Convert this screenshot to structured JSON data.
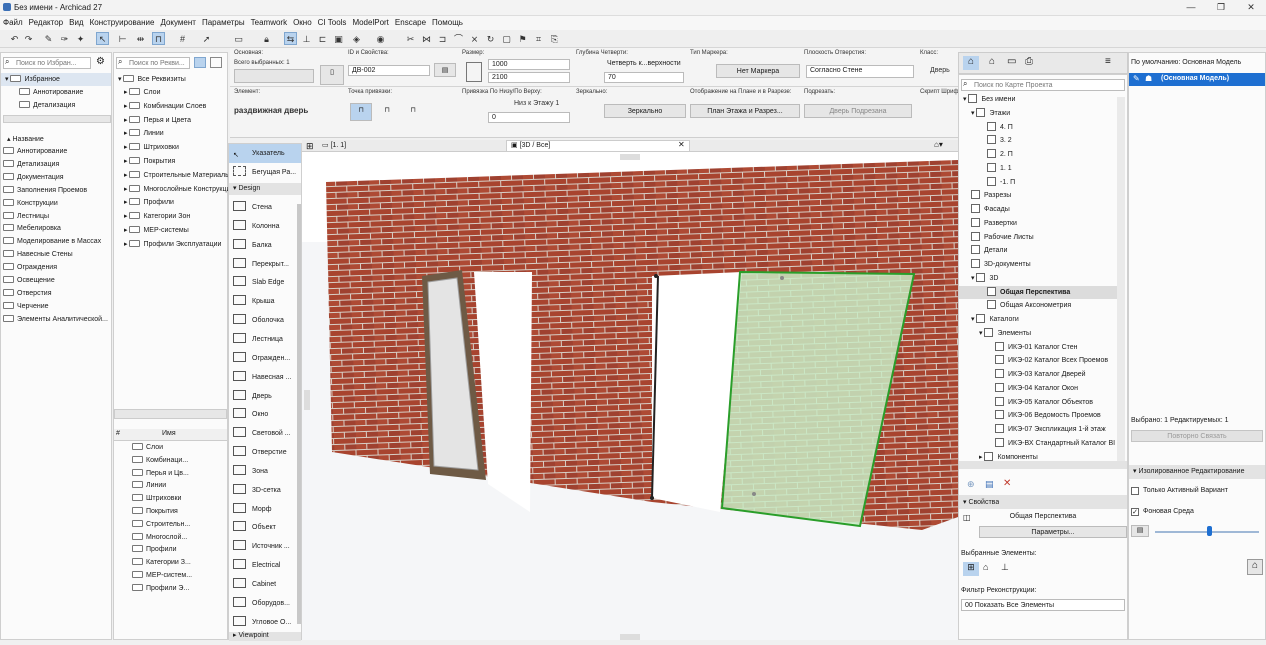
{
  "window": {
    "title": "Без имени - Archicad 27"
  },
  "menu": [
    "Файл",
    "Редактор",
    "Вид",
    "Конструирование",
    "Документ",
    "Параметры",
    "Teamwork",
    "Окно",
    "CI Tools",
    "ModelPort",
    "Enscape",
    "Помощь"
  ],
  "left": {
    "search_placeholder": "Поиск по Избран...",
    "tab": "Избранное",
    "tree": [
      "Аннотирование",
      "Детализация"
    ],
    "name_header": "Название",
    "groups": [
      "Аннотирование",
      "Детализация",
      "Документация",
      "Заполнения Проемов",
      "Конструкции",
      "Лестницы",
      "Мебелировка",
      "Моделирование в Массах",
      "Навесные Стены",
      "Ограждения",
      "Освещение",
      "Отверстия",
      "Черчение",
      "Элементы Аналитической..."
    ]
  },
  "attr": {
    "search_placeholder": "Поиск по Рекви...",
    "root": "Все Реквизиты",
    "items": [
      "Слои",
      "Комбинации Слоев",
      "Перья и Цвета",
      "Линии",
      "Штриховки",
      "Покрытия",
      "Строительные Материалы",
      "Многослойные Конструкции",
      "Профили",
      "Категории Зон",
      "MEP-системы",
      "Профили Эксплуатации"
    ],
    "list_header_num": "#",
    "list_header_name": "Имя",
    "list": [
      "Слои",
      "Комбинаци...",
      "Перья и Цв...",
      "Линии",
      "Штриховки",
      "Покрытия",
      "Строительн...",
      "Многослой...",
      "Профили",
      "Категории З...",
      "MEP-систем...",
      "Профили Э..."
    ]
  },
  "info": {
    "basic_label": "Основная:",
    "total_selected": "Всего выбранных: 1",
    "id_label": "ID и Свойства:",
    "id_value": "ДВ-002",
    "size_label": "Размер:",
    "width": "1000",
    "height": "2100",
    "quarter_label": "Глубина Четверти:",
    "quarter_value": "Четверть к...верхности",
    "quarter_depth": "70",
    "marker_label": "Тип Маркера:",
    "marker_value": "Нет Маркера",
    "plane_label": "Плоскость Отверстия:",
    "plane_value": "Согласно Стене",
    "class_label": "Класс:",
    "class_value": "Дверь",
    "element_label": "Элемент:",
    "element_value": "раздвижная дверь",
    "anchor_label": "Точка привязки:",
    "ref_label": "Привязка По Низу/По Верху:",
    "ref_value": "Низ к Этажу 1",
    "ref_offset": "0",
    "mirror_label": "Зеркально:",
    "mirror_value": "Зеркально",
    "display_label": "Отображение на Плане и в Разрезе:",
    "display_value": "План Этажа и Разрез...",
    "caption_label": "Подрезать:",
    "caption_value": "Дверь Подрезана",
    "script_label": "Скрипт Шрифт"
  },
  "toolbox": {
    "pointer": "Указатель",
    "marquee": "Бегущая Ра...",
    "design": "Design",
    "tools": [
      "Стена",
      "Колонна",
      "Балка",
      "Перекрыт...",
      "Slab Edge",
      "Крыша",
      "Оболочка",
      "Лестница",
      "Огражден...",
      "Навесная ...",
      "Дверь",
      "Окно",
      "Световой ...",
      "Отверстие",
      "Зона",
      "3D-сетка",
      "Морф",
      "Объект",
      "Источник ...",
      "Electrical",
      "Cabinet",
      "Оборудов...",
      "Угловое О..."
    ],
    "viewpoint": "Viewpoint"
  },
  "view": {
    "tab_plan": "[1. 1]",
    "tab_3d": "[3D / Все]"
  },
  "navigator": {
    "search_placeholder": "Поиск по Карте Проекта",
    "root": "Без имени",
    "stories": "Этажи",
    "story_list": [
      "4. П",
      "3. 2",
      "2. П",
      "1. 1",
      "-1. П"
    ],
    "views": [
      "Разрезы",
      "Фасады",
      "Развертки",
      "Рабочие Листы",
      "Детали",
      "3D-документы"
    ],
    "threed": "3D",
    "perspective": "Общая Перспектива",
    "axonometry": "Общая Аксонометрия",
    "catalogs": "Каталоги",
    "elements": "Элементы",
    "catalog_list": [
      "ИКЭ-01 Каталог Стен",
      "ИКЭ-02 Каталог Всех Проемов",
      "ИКЭ-03 Каталог Дверей",
      "ИКЭ-04 Каталог Окон",
      "ИКЭ-05 Каталог Объектов",
      "ИКЭ-06 Ведомость Проемов",
      "ИКЭ-07 Экспликация 1-й этаж",
      "ИКЭ-ВХ Стандартный Каталог BIMx"
    ],
    "components": "Компоненты",
    "properties": "Свойства",
    "prop_name": "Общая Перспектива",
    "params": "Параметры...",
    "selected_elements": "Выбранные Элементы:",
    "filter_label": "Фильтр Реконструкции:",
    "filter_value": "00 Показать Все Элементы"
  },
  "right": {
    "default_label": "По умолчанию: Основная Модель",
    "model": "(Основная Модель)",
    "selected": "Выбрано: 1 Редактируемых: 1",
    "relink": "Повторно Связать",
    "isolated": "Изолированное Редактирование",
    "active_only": "Только Активный Вариант",
    "background": "Фоновая Среда"
  }
}
